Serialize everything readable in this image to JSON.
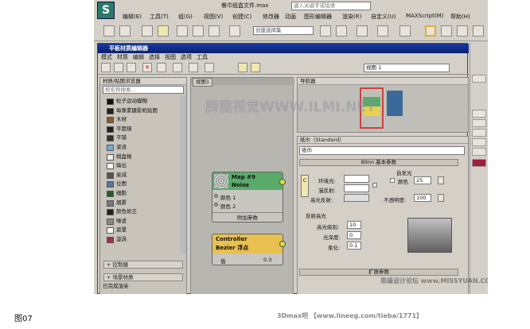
{
  "app": {
    "title": "餐巾纸盒文件.max",
    "search_placeholder": "键入关键字或短语"
  },
  "menubar": [
    "编辑(E)",
    "工具(T)",
    "组(G)",
    "视图(V)",
    "创建(C)",
    "修改器",
    "动画",
    "图形编辑器",
    "渲染(R)",
    "自定义(U)",
    "MAXScript(M)",
    "帮助(H)"
  ],
  "toolbar": {
    "selection_set": "创建选择集"
  },
  "editor": {
    "title": "平板材质编辑器",
    "menu": [
      "模式",
      "材质",
      "编辑",
      "选择",
      "视图",
      "选项",
      "工具"
    ]
  },
  "browser": {
    "header": "材质/贴图浏览器",
    "search": "按名称搜索...",
    "items": [
      {
        "name": "粒子运动模糊",
        "color": "#111111"
      },
      {
        "name": "每像素摄影机贴图",
        "color": "#222222"
      },
      {
        "name": "木材",
        "color": "#8a5a2a"
      },
      {
        "name": "平面镜",
        "color": "#222222"
      },
      {
        "name": "平铺",
        "color": "#333333"
      },
      {
        "name": "波浪",
        "color": "#6ab0d0"
      },
      {
        "name": "棋盘格",
        "color": "#eeeeee"
      },
      {
        "name": "输出",
        "color": "#ffffff"
      },
      {
        "name": "衰减",
        "color": "#555555"
      },
      {
        "name": "位图",
        "color": "#5a7a9a"
      },
      {
        "name": "细胞",
        "color": "#2a5a2a"
      },
      {
        "name": "烟雾",
        "color": "#777777"
      },
      {
        "name": "颜色修正",
        "color": "#222222"
      },
      {
        "name": "噪波",
        "color": "#888888"
      },
      {
        "name": "遮罩",
        "color": "#ffffff"
      },
      {
        "name": "漩涡",
        "color": "#a03050"
      }
    ],
    "sections": [
      "+ 控制器",
      "+ 场景材质"
    ]
  },
  "graph": {
    "view_tab": "视图1",
    "node1": {
      "title": "Map #9",
      "sub": "Noise",
      "slots": [
        "颜色 1",
        "颜色 2"
      ],
      "footer": "附加参数"
    },
    "node2": {
      "title": "Controller",
      "sub": "Bezier 浮点",
      "value_label": "值",
      "value": "0.3"
    }
  },
  "navigator": {
    "label": "导航器",
    "view": "视图 1"
  },
  "params": {
    "header": "纸巾（Standard）",
    "name": "纸巾",
    "blinn_rollout": "Blinn 基本参数",
    "self_illum": "自发光",
    "color_label": "颜色",
    "color_value": "25",
    "ambient": "环境光:",
    "diffuse": "漫反射:",
    "specular": "高光反射:",
    "opacity_label": "不透明度:",
    "opacity": "100",
    "highlight_group": "反射高光",
    "gloss_level": "高光级别:",
    "gloss_level_value": "10",
    "glossiness": "光泽度:",
    "glossiness_value": "0",
    "soften": "柔化:",
    "soften_value": "0.1",
    "extended": "扩展参数",
    "c_btn": "C"
  },
  "status": "已完成渲染",
  "watermarks": [
    "腾龍视觉WWW.ILMI.NET",
    "思缘设计论坛 www.MISSYUAN.COM"
  ],
  "footer": {
    "caption": "图07",
    "credit": "3Dmax吧 【www.lineeg.com/tieba/1771】"
  },
  "colors": {
    "node_green": "#5aaa6a",
    "node_yellow": "#e8c050",
    "accent_red": "#d04040",
    "nav_blue": "#3a6a9a"
  }
}
